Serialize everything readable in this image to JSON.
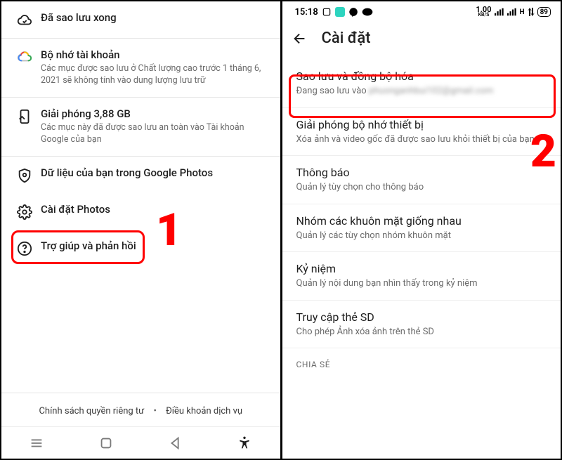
{
  "annotations": {
    "step1": "1",
    "step2": "2"
  },
  "left": {
    "backup_done": "Đã sao lưu xong",
    "account_storage_title": "Bộ nhớ tài khoản",
    "account_storage_sub": "Các mục được sao lưu ở Chất lượng cao trước 1 tháng 6, 2021 sẽ không tính vào dung lượng lưu trữ",
    "free_up_title": "Giải phóng 3,88 GB",
    "free_up_sub": "Các mục này đã được sao lưu an toàn vào Tài khoản Google của bạn",
    "your_data": "Dữ liệu của bạn trong Google Photos",
    "photos_settings": "Cài đặt Photos",
    "help": "Trợ giúp và phản hồi",
    "privacy": "Chính sách quyền riêng tư",
    "terms": "Điều khoản dịch vụ"
  },
  "right": {
    "status_time": "15:18",
    "status_speed": "1.00",
    "status_speed_unit": "KB/S",
    "status_net": "H",
    "status_batt": "89",
    "header": "Cài đặt",
    "backup_title": "Sao lưu và đồng bộ hóa",
    "backup_sub_prefix": "Đang sao lưu vào ",
    "backup_sub_blur": "phuonganhbui102@gmail.com",
    "free_device_title": "Giải phóng bộ nhớ thiết bị",
    "free_device_sub": "Xóa ảnh và video gốc đã được sao lưu khỏi thiết bị của bạn",
    "notif_title": "Thông báo",
    "notif_sub": "Quản lý tùy chọn cho thông báo",
    "faces_title": "Nhóm các khuôn mặt giống nhau",
    "faces_sub": "Quản lý các tùy chọn nhóm khuôn mặt",
    "memories_title": "Kỷ niệm",
    "memories_sub": "Quản lý nội dung bạn nhìn thấy trong kỷ niệm",
    "sd_title": "Truy cập thẻ SD",
    "sd_sub": "Cho phép Ảnh xóa ảnh trên thẻ SD",
    "share_section": "CHIA SẺ"
  }
}
